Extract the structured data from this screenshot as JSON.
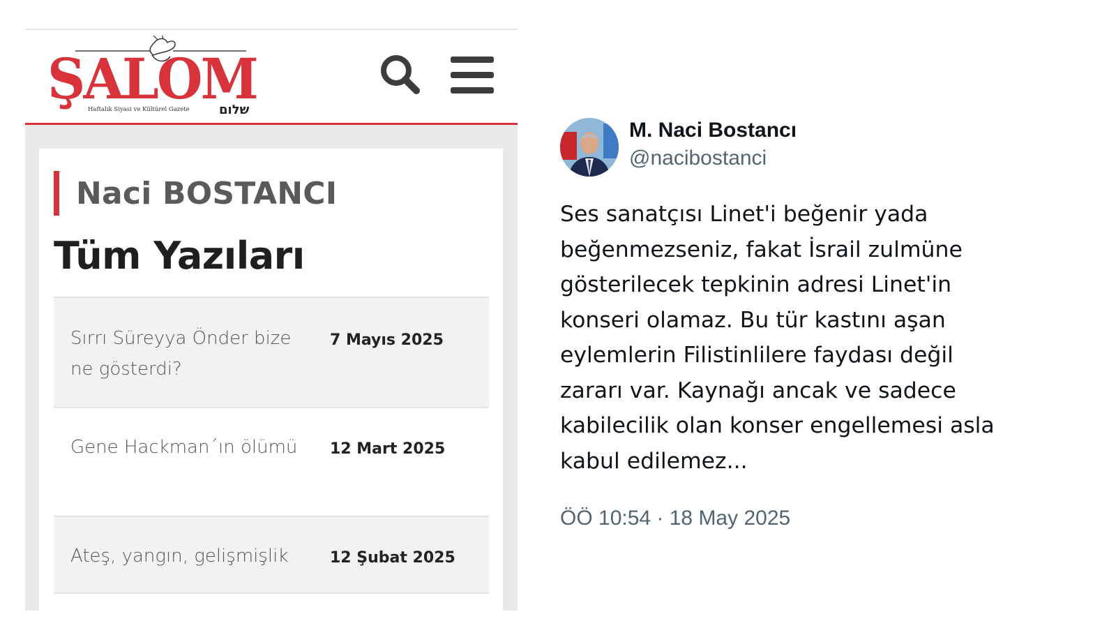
{
  "salom": {
    "logo_text": "ŞALOM",
    "logo_hebrew": "שלום",
    "logo_tagline": "Haftalık Siyasi ve Kültürel Gazete",
    "search_icon": "search-icon",
    "menu_icon": "hamburger-menu-icon",
    "brand_color": "#d8333a",
    "author_name": "Naci BOSTANCI",
    "section_title": "Tüm Yazıları",
    "articles": [
      {
        "title": "Sırrı Süreyya Önder bize ne gösterdi?",
        "date": "7 Mayıs 2025"
      },
      {
        "title": "Gene Hackman´ın ölümü",
        "date": "12 Mart 2025"
      },
      {
        "title": "Ateş, yangın, gelişmişlik",
        "date": "12 Şubat 2025"
      }
    ]
  },
  "tweet": {
    "display_name": "M. Naci Bostancı",
    "handle": "@nacibostanci",
    "text": "Ses sanatçısı Linet'i beğenir yada\nbeğenmezseniz, fakat İsrail zulmüne\ngösterilecek tepkinin adresi Linet'in\nkonseri olamaz. Bu tür kastını aşan\neylemlerin Filistinlilere faydası değil\nzararı var. Kaynağı ancak ve sadece\nkabilecilik olan konser engellemesi asla\nkabul edilemez...",
    "meta": "ÖÖ 10:54 · 18 May 2025",
    "text_color": "#0f1419",
    "secondary_color": "#536471"
  }
}
